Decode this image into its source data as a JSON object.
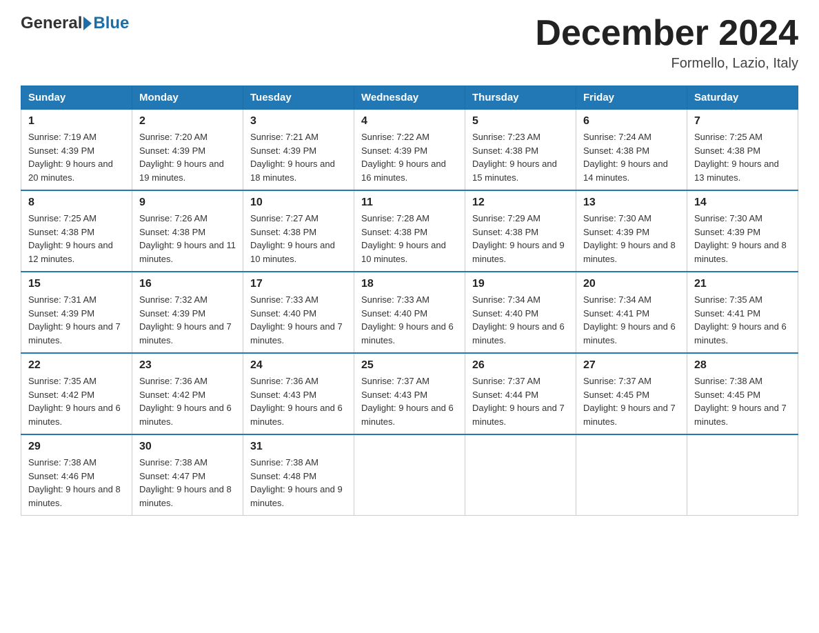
{
  "header": {
    "logo_general": "General",
    "logo_blue": "Blue",
    "month_title": "December 2024",
    "location": "Formello, Lazio, Italy"
  },
  "days_of_week": [
    "Sunday",
    "Monday",
    "Tuesday",
    "Wednesday",
    "Thursday",
    "Friday",
    "Saturday"
  ],
  "weeks": [
    [
      {
        "num": "1",
        "sunrise": "7:19 AM",
        "sunset": "4:39 PM",
        "daylight": "9 hours and 20 minutes."
      },
      {
        "num": "2",
        "sunrise": "7:20 AM",
        "sunset": "4:39 PM",
        "daylight": "9 hours and 19 minutes."
      },
      {
        "num": "3",
        "sunrise": "7:21 AM",
        "sunset": "4:39 PM",
        "daylight": "9 hours and 18 minutes."
      },
      {
        "num": "4",
        "sunrise": "7:22 AM",
        "sunset": "4:39 PM",
        "daylight": "9 hours and 16 minutes."
      },
      {
        "num": "5",
        "sunrise": "7:23 AM",
        "sunset": "4:38 PM",
        "daylight": "9 hours and 15 minutes."
      },
      {
        "num": "6",
        "sunrise": "7:24 AM",
        "sunset": "4:38 PM",
        "daylight": "9 hours and 14 minutes."
      },
      {
        "num": "7",
        "sunrise": "7:25 AM",
        "sunset": "4:38 PM",
        "daylight": "9 hours and 13 minutes."
      }
    ],
    [
      {
        "num": "8",
        "sunrise": "7:25 AM",
        "sunset": "4:38 PM",
        "daylight": "9 hours and 12 minutes."
      },
      {
        "num": "9",
        "sunrise": "7:26 AM",
        "sunset": "4:38 PM",
        "daylight": "9 hours and 11 minutes."
      },
      {
        "num": "10",
        "sunrise": "7:27 AM",
        "sunset": "4:38 PM",
        "daylight": "9 hours and 10 minutes."
      },
      {
        "num": "11",
        "sunrise": "7:28 AM",
        "sunset": "4:38 PM",
        "daylight": "9 hours and 10 minutes."
      },
      {
        "num": "12",
        "sunrise": "7:29 AM",
        "sunset": "4:38 PM",
        "daylight": "9 hours and 9 minutes."
      },
      {
        "num": "13",
        "sunrise": "7:30 AM",
        "sunset": "4:39 PM",
        "daylight": "9 hours and 8 minutes."
      },
      {
        "num": "14",
        "sunrise": "7:30 AM",
        "sunset": "4:39 PM",
        "daylight": "9 hours and 8 minutes."
      }
    ],
    [
      {
        "num": "15",
        "sunrise": "7:31 AM",
        "sunset": "4:39 PM",
        "daylight": "9 hours and 7 minutes."
      },
      {
        "num": "16",
        "sunrise": "7:32 AM",
        "sunset": "4:39 PM",
        "daylight": "9 hours and 7 minutes."
      },
      {
        "num": "17",
        "sunrise": "7:33 AM",
        "sunset": "4:40 PM",
        "daylight": "9 hours and 7 minutes."
      },
      {
        "num": "18",
        "sunrise": "7:33 AM",
        "sunset": "4:40 PM",
        "daylight": "9 hours and 6 minutes."
      },
      {
        "num": "19",
        "sunrise": "7:34 AM",
        "sunset": "4:40 PM",
        "daylight": "9 hours and 6 minutes."
      },
      {
        "num": "20",
        "sunrise": "7:34 AM",
        "sunset": "4:41 PM",
        "daylight": "9 hours and 6 minutes."
      },
      {
        "num": "21",
        "sunrise": "7:35 AM",
        "sunset": "4:41 PM",
        "daylight": "9 hours and 6 minutes."
      }
    ],
    [
      {
        "num": "22",
        "sunrise": "7:35 AM",
        "sunset": "4:42 PM",
        "daylight": "9 hours and 6 minutes."
      },
      {
        "num": "23",
        "sunrise": "7:36 AM",
        "sunset": "4:42 PM",
        "daylight": "9 hours and 6 minutes."
      },
      {
        "num": "24",
        "sunrise": "7:36 AM",
        "sunset": "4:43 PM",
        "daylight": "9 hours and 6 minutes."
      },
      {
        "num": "25",
        "sunrise": "7:37 AM",
        "sunset": "4:43 PM",
        "daylight": "9 hours and 6 minutes."
      },
      {
        "num": "26",
        "sunrise": "7:37 AM",
        "sunset": "4:44 PM",
        "daylight": "9 hours and 7 minutes."
      },
      {
        "num": "27",
        "sunrise": "7:37 AM",
        "sunset": "4:45 PM",
        "daylight": "9 hours and 7 minutes."
      },
      {
        "num": "28",
        "sunrise": "7:38 AM",
        "sunset": "4:45 PM",
        "daylight": "9 hours and 7 minutes."
      }
    ],
    [
      {
        "num": "29",
        "sunrise": "7:38 AM",
        "sunset": "4:46 PM",
        "daylight": "9 hours and 8 minutes."
      },
      {
        "num": "30",
        "sunrise": "7:38 AM",
        "sunset": "4:47 PM",
        "daylight": "9 hours and 8 minutes."
      },
      {
        "num": "31",
        "sunrise": "7:38 AM",
        "sunset": "4:48 PM",
        "daylight": "9 hours and 9 minutes."
      },
      null,
      null,
      null,
      null
    ]
  ]
}
